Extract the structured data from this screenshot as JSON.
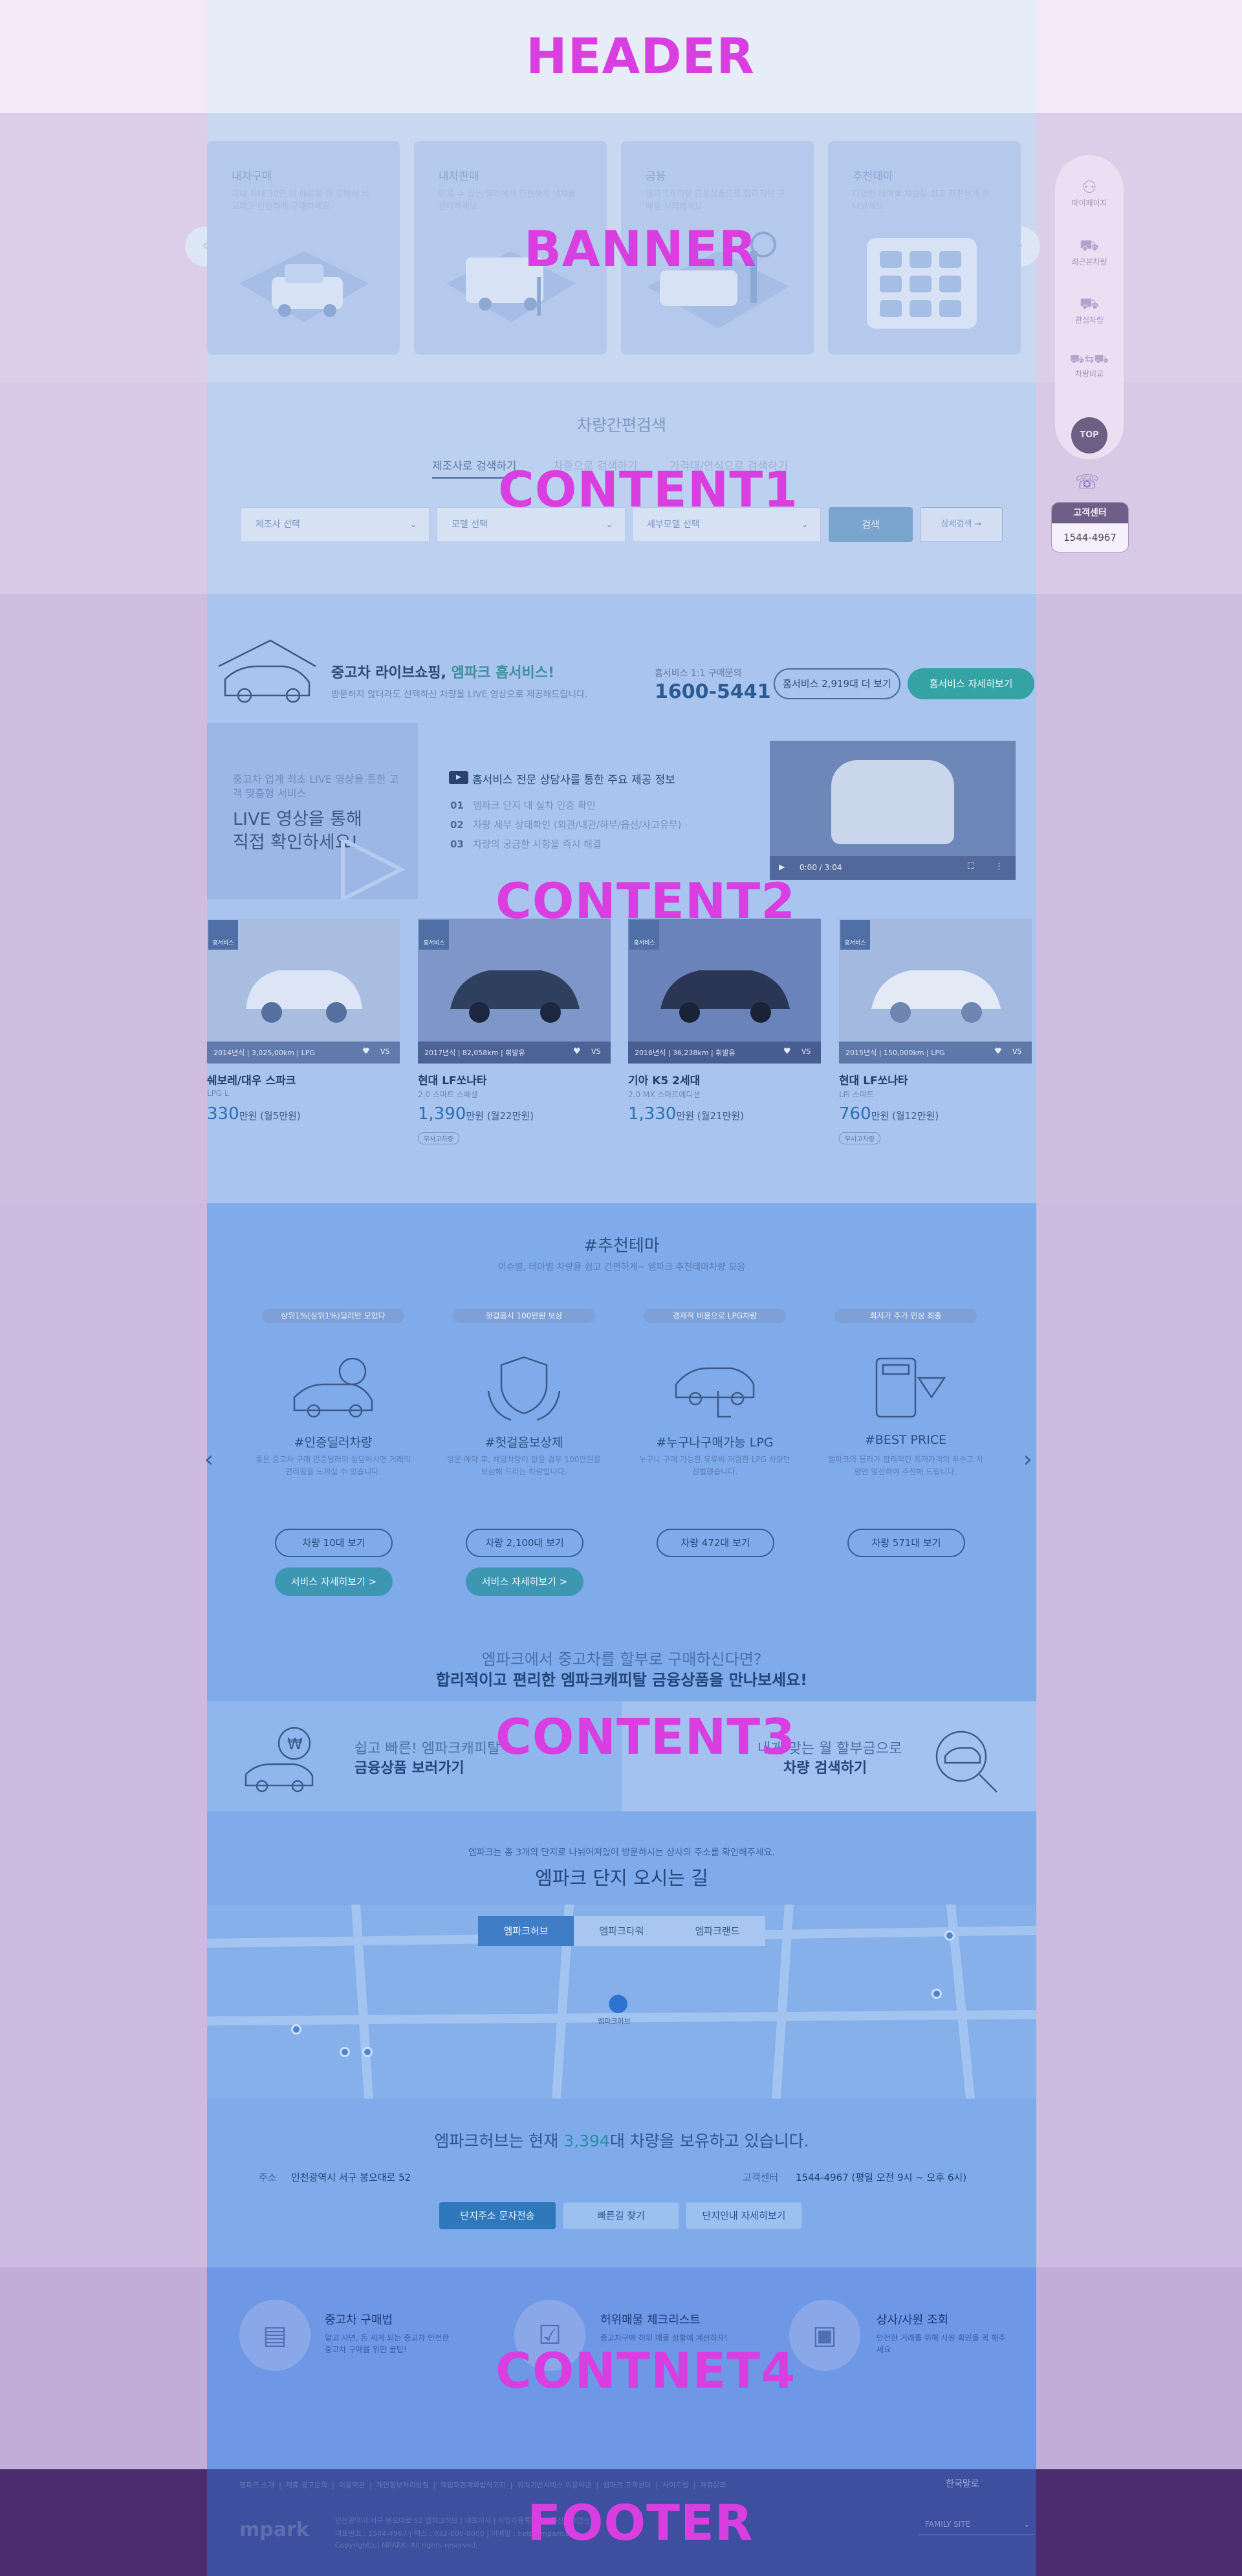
{
  "regions": {
    "header": "HEADER",
    "banner": "BANNER",
    "content1": "CONTENT1",
    "content2": "CONTENT2",
    "content3": "CONTENT3",
    "content4": "CONTNET4",
    "footer": "FOOTER"
  },
  "banner": {
    "cards": [
      {
        "title": "내차구매",
        "desc": "국내 최대 30만 대 매물을 한 곳에서 비교하고 안전하게 구매하세요"
      },
      {
        "title": "내차판매",
        "desc": "믿을 수 있는 딜러에게 간편하게 내차를 판매하세요"
      },
      {
        "title": "금융",
        "desc": "엠파크캐피탈 금융상품으로 합리적인 구매를 시작하세요"
      },
      {
        "title": "추천테마",
        "desc": "다양한 테마별 차량을 쉽고 간편하게 만나보세요"
      }
    ],
    "prev": "‹",
    "next": "›"
  },
  "sidebar": {
    "items": [
      "마이페이지",
      "최근본차량",
      "관심차량",
      "차량비교"
    ],
    "top": "TOP",
    "cs_label": "고객센터",
    "cs_phone": "1544-4967"
  },
  "search": {
    "title": "차량간편검색",
    "tabs": [
      "제조사로 검색하기",
      "차종으로 검색하기",
      "가격대/연식으로 검색하기"
    ],
    "selects": [
      "제조사 선택",
      "모델 선택",
      "세부모델 선택"
    ],
    "search_btn": "검색",
    "detail_btn": "상세검색 →"
  },
  "homeservice": {
    "title_pre": "중고차 라이브쇼핑, ",
    "title_brand": "엠파크 홈서비스!",
    "sub": "방문하지 않더라도 선택하신 차량을 LIVE 영상으로 제공해드립니다.",
    "call_label": "홈서비스 1:1 구매문의",
    "call_number": "1600-5441",
    "count_btn": "홈서비스 2,919대 더 보기",
    "detail_btn": "홈서비스 자세히보기",
    "live_small": "중고차 업계 최초 LIVE 영상을 통한 고객 맞춤형 서비스",
    "live_big1": "LIVE 영상을 통해",
    "live_big2": "직접 확인하세요!",
    "info_title": "홈서비스 전문 상담사를 통한 주요 제공 정보",
    "info_items": [
      {
        "no": "01",
        "text": "엠파크 단지 내 실차 인증 확인"
      },
      {
        "no": "02",
        "text": "차량 세부 상태확인 (외관/내관/하부/옵션/사고유무)"
      },
      {
        "no": "03",
        "text": "차량의 궁금한 사항을 즉시 해결"
      }
    ],
    "video_time": "0:00 / 3:04"
  },
  "cars": [
    {
      "badge": "홈서비스",
      "meta": "2014년식 | 3,025,00km | LPG",
      "name": "쉐보레/대우 스파크",
      "trim": "LPG L",
      "price": "330",
      "unit": "만원",
      "monthly": "(월5만원)",
      "label": "",
      "heart": "♥",
      "vs": "VS"
    },
    {
      "badge": "홈서비스",
      "meta": "2017년식 | 82,058km | 휘발유",
      "name": "현대 LF쏘나타",
      "trim": "2.0 스마트 스페셜",
      "price": "1,390",
      "unit": "만원",
      "monthly": "(월22만원)",
      "label": "무사고차량",
      "heart": "♥",
      "vs": "VS"
    },
    {
      "badge": "홈서비스",
      "meta": "2016년식 | 36,238km | 휘발유",
      "name": "기아 K5 2세대",
      "trim": "2.0 MX 스마트에디션",
      "price": "1,330",
      "unit": "만원",
      "monthly": "(월21만원)",
      "label": "",
      "heart": "♥",
      "vs": "VS"
    },
    {
      "badge": "홈서비스",
      "meta": "2015년식 | 150,000km | LPG",
      "name": "현대 LF쏘나타",
      "trim": "LPi 스마트",
      "price": "760",
      "unit": "만원",
      "monthly": "(월12만원)",
      "label": "무사고차량",
      "heart": "♥",
      "vs": "VS"
    }
  ],
  "theme": {
    "title": "#추천테마",
    "sub": "이슈별, 테마별 차량을 쉽고 간편하게~ 엠파크 추천테마차량 모음",
    "items": [
      {
        "tag": "상위1%(상위1%)딜러만 모았다",
        "title": "#인증딜러차량",
        "desc": "좋은 중고차 구매 인증딜러와 상담하시면 거래의 편리함을 느끼실 수 있습니다.",
        "btn": "차량 10대 보기",
        "detail": "서비스 자세히보기 >"
      },
      {
        "tag": "헛걸음시 100만원 보상",
        "title": "#헛걸음보상제",
        "desc": "방문 예약 후, 해당차량이 없을 경우 100만원을 보상해 드리는 차량입니다.",
        "btn": "차량 2,100대 보기",
        "detail": "서비스 자세히보기 >"
      },
      {
        "tag": "경제적 비용으로 LPG차량",
        "title": "#누구나구매가능 LPG",
        "desc": "누구나 구매 가능한 유류비 저렴한 LPG 차량만 선별했습니다.",
        "btn": "차량 472대 보기",
        "detail": ""
      },
      {
        "tag": "최저가 추가 인상 최종",
        "title": "#BEST PRICE",
        "desc": "엠파크의 딜러가 합리적인 최저가격의 우수고 차량만 엄선하여 추천해 드립니다.",
        "btn": "차량 571대 보기",
        "detail": ""
      }
    ],
    "prev": "‹",
    "next": "›"
  },
  "finance": {
    "q": "엠파크에서 중고차를 할부로 구매하신다면?",
    "title": "합리적이고 편리한 엠파크캐피탈 금융상품을 만나보세요!",
    "left_small": "쉽고 빠른! 엠파크캐피탈",
    "left_big": "금융상품 보러가기",
    "right_small": "내게 맞는 월 할부금으로",
    "right_big": "차량 검색하기"
  },
  "location": {
    "small": "엠파크는 총 3개의 단지로 나뉘어져있어 방문하시는 상사의 주소를 확인해주세요.",
    "title": "엠파크 단지 오시는 길",
    "tabs": [
      "엠파크허브",
      "엠파크타워",
      "엠파크랜드"
    ],
    "count_pre": "엠파크허브는 현재 ",
    "count_num": "3,394",
    "count_post": "대 차량을 보유하고 있습니다.",
    "addr_label": "주소",
    "addr": "인천광역시 서구 봉오대로 52",
    "cs_label": "고객센터",
    "cs": "1544-4967 (평일 오전 9시 ~ 오후 6시)",
    "btns": [
      "단지주소 문자전송",
      "빠른길 찾기",
      "단지안내 자세히보기"
    ],
    "pin": "엠파크허브"
  },
  "guides": [
    {
      "title": "중고차 구매법",
      "desc": "알고 사면, 돈 세게 되는 중고차 안전한 중고차 구매를 위한 꿀팁!"
    },
    {
      "title": "허위매물 체크리스트",
      "desc": "중고차구매 허위 매물 상황에 계산하자!"
    },
    {
      "title": "상사/사원 조회",
      "desc": "안전한 거래를 위해 사원 확인을 꼭 해주세요"
    }
  ],
  "footer": {
    "links": [
      "엠파크 소개",
      "제휴 광고문의",
      "이용약관",
      "개인정보처리방침",
      "책임의한계와법적고지",
      "위치기반서비스 이용약관",
      "엠파크 고객센터",
      "사이트맵",
      "제휴문의"
    ],
    "lang": "한국말로",
    "logo": "mpark",
    "addr": "인천광역시 서구 봉오대로 52 엠파크허브 | 대표이사 | 사업자등록번호 | 통신판매업신고",
    "addr2": "대표번호 : 1544-4967 | 팩스 : 032-000-0000 | 이메일 : help@mpark.com",
    "copy": "Copyright(c) MPARK. All rights reserved.",
    "family": "FAMILY SITE"
  }
}
